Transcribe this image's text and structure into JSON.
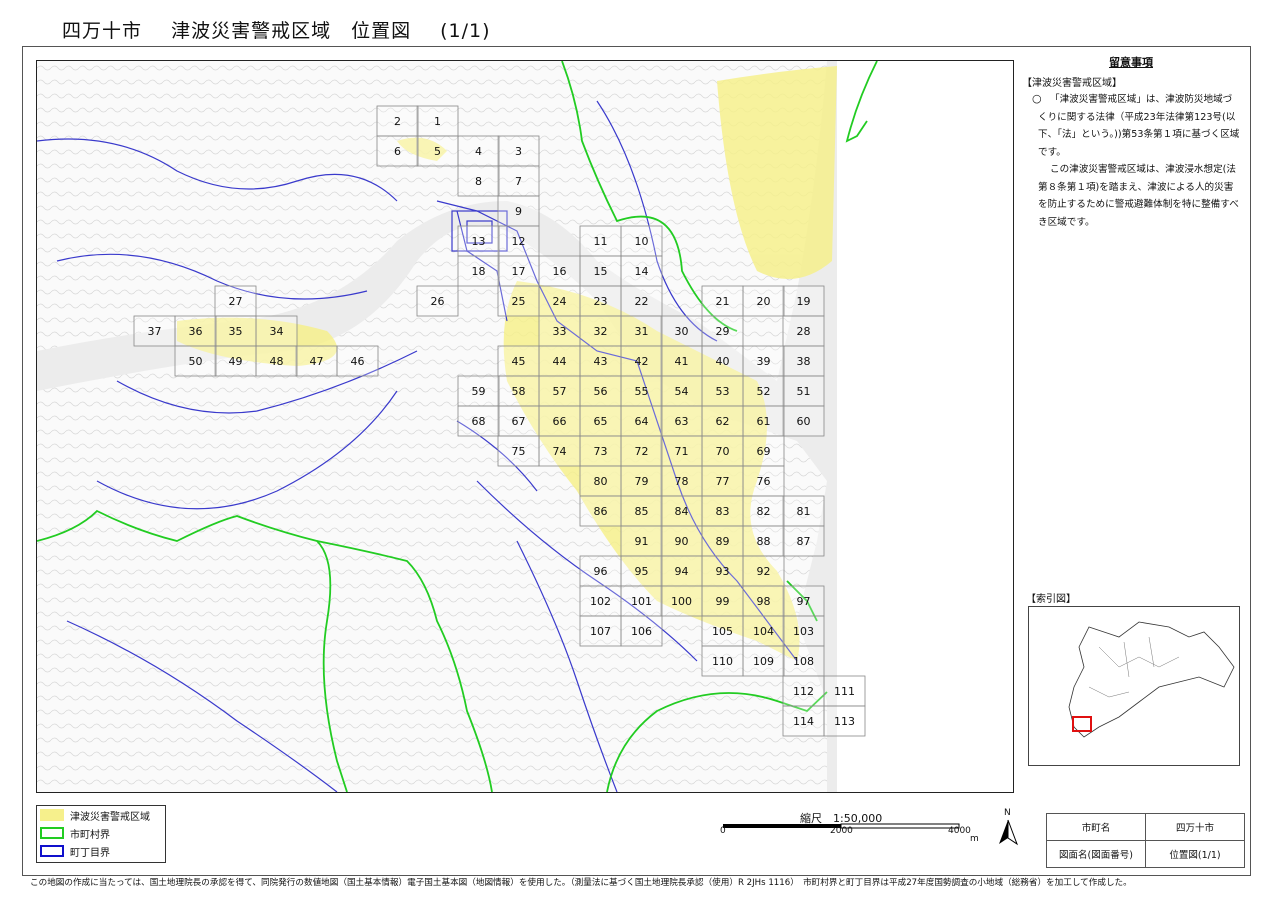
{
  "header": {
    "city": "四万十市",
    "subject": "津波災害警戒区域　位置図",
    "page": "(1/1)"
  },
  "notes": {
    "heading": "留意事項",
    "section": "【津波災害警戒区域】",
    "bullet": "○",
    "para1": "「津波災害警戒区域」は、津波防災地域づくりに関する法律（平成23年法律第123号(以下、「法」という。))第53条第１項に基づく区域です。",
    "para2": "この津波災害警戒区域は、津波浸水想定(法第８条第１項)を踏まえ、津波による人的災害を防止するために警戒避難体制を特に整備すべき区域です。"
  },
  "index_map": {
    "label": "【索引図】"
  },
  "legend": {
    "items": [
      {
        "label": "津波災害警戒区域",
        "color": "#f6f08c"
      },
      {
        "label": "市町村界",
        "color": "#22cc22"
      },
      {
        "label": "町丁目界",
        "color": "#1010cc"
      }
    ]
  },
  "scale": {
    "label": "縮尺　1:50,000",
    "ticks": [
      "0",
      "2000",
      "4000"
    ],
    "unit": "m"
  },
  "north": "N",
  "title_block": {
    "row1_label": "市町名",
    "row1_value": "四万十市",
    "row2_label": "図面名(図面番号)",
    "row2_value": "位置図(1/1)"
  },
  "footer": "この地図の作成に当たっては、国土地理院長の承認を得て、同院発行の数値地図（国土基本情報）電子国土基本図（地図情報）を使用した。（測量法に基づく国土地理院長承認（使用）R 2JHs 1116）　市町村界と町丁目界は平成27年度国勢調査の小地域（総務省）を加工して作成した。",
  "map": {
    "colors": {
      "zone": "#f6f08c",
      "city_boundary": "#22cc22",
      "town_boundary": "#3a3acc",
      "grid": "#888888"
    },
    "sheets": [
      {
        "n": "1"
      },
      {
        "n": "2"
      },
      {
        "n": "3"
      },
      {
        "n": "4"
      },
      {
        "n": "5"
      },
      {
        "n": "6"
      },
      {
        "n": "7"
      },
      {
        "n": "8"
      },
      {
        "n": "9"
      },
      {
        "n": "10"
      },
      {
        "n": "11"
      },
      {
        "n": "12"
      },
      {
        "n": "13"
      },
      {
        "n": "14"
      },
      {
        "n": "15"
      },
      {
        "n": "16"
      },
      {
        "n": "17"
      },
      {
        "n": "18"
      },
      {
        "n": "19"
      },
      {
        "n": "20"
      },
      {
        "n": "21"
      },
      {
        "n": "22"
      },
      {
        "n": "23"
      },
      {
        "n": "24"
      },
      {
        "n": "25"
      },
      {
        "n": "26"
      },
      {
        "n": "27"
      },
      {
        "n": "28"
      },
      {
        "n": "29"
      },
      {
        "n": "30"
      },
      {
        "n": "31"
      },
      {
        "n": "32"
      },
      {
        "n": "33"
      },
      {
        "n": "34"
      },
      {
        "n": "35"
      },
      {
        "n": "36"
      },
      {
        "n": "37"
      },
      {
        "n": "38"
      },
      {
        "n": "39"
      },
      {
        "n": "40"
      },
      {
        "n": "41"
      },
      {
        "n": "42"
      },
      {
        "n": "43"
      },
      {
        "n": "44"
      },
      {
        "n": "45"
      },
      {
        "n": "46"
      },
      {
        "n": "47"
      },
      {
        "n": "48"
      },
      {
        "n": "49"
      },
      {
        "n": "50"
      },
      {
        "n": "51"
      },
      {
        "n": "52"
      },
      {
        "n": "53"
      },
      {
        "n": "54"
      },
      {
        "n": "55"
      },
      {
        "n": "56"
      },
      {
        "n": "57"
      },
      {
        "n": "58"
      },
      {
        "n": "59"
      },
      {
        "n": "60"
      },
      {
        "n": "61"
      },
      {
        "n": "62"
      },
      {
        "n": "63"
      },
      {
        "n": "64"
      },
      {
        "n": "65"
      },
      {
        "n": "66"
      },
      {
        "n": "67"
      },
      {
        "n": "68"
      },
      {
        "n": "69"
      },
      {
        "n": "70"
      },
      {
        "n": "71"
      },
      {
        "n": "72"
      },
      {
        "n": "73"
      },
      {
        "n": "74"
      },
      {
        "n": "75"
      },
      {
        "n": "76"
      },
      {
        "n": "77"
      },
      {
        "n": "78"
      },
      {
        "n": "79"
      },
      {
        "n": "80"
      },
      {
        "n": "81"
      },
      {
        "n": "82"
      },
      {
        "n": "83"
      },
      {
        "n": "84"
      },
      {
        "n": "85"
      },
      {
        "n": "86"
      },
      {
        "n": "87"
      },
      {
        "n": "88"
      },
      {
        "n": "89"
      },
      {
        "n": "90"
      },
      {
        "n": "91"
      },
      {
        "n": "92"
      },
      {
        "n": "93"
      },
      {
        "n": "94"
      },
      {
        "n": "95"
      },
      {
        "n": "96"
      },
      {
        "n": "97"
      },
      {
        "n": "98"
      },
      {
        "n": "99"
      },
      {
        "n": "100"
      },
      {
        "n": "101"
      },
      {
        "n": "102"
      },
      {
        "n": "103"
      },
      {
        "n": "104"
      },
      {
        "n": "105"
      },
      {
        "n": "106"
      },
      {
        "n": "107"
      },
      {
        "n": "108"
      },
      {
        "n": "109"
      },
      {
        "n": "110"
      },
      {
        "n": "111"
      },
      {
        "n": "112"
      },
      {
        "n": "113"
      },
      {
        "n": "114"
      }
    ]
  }
}
